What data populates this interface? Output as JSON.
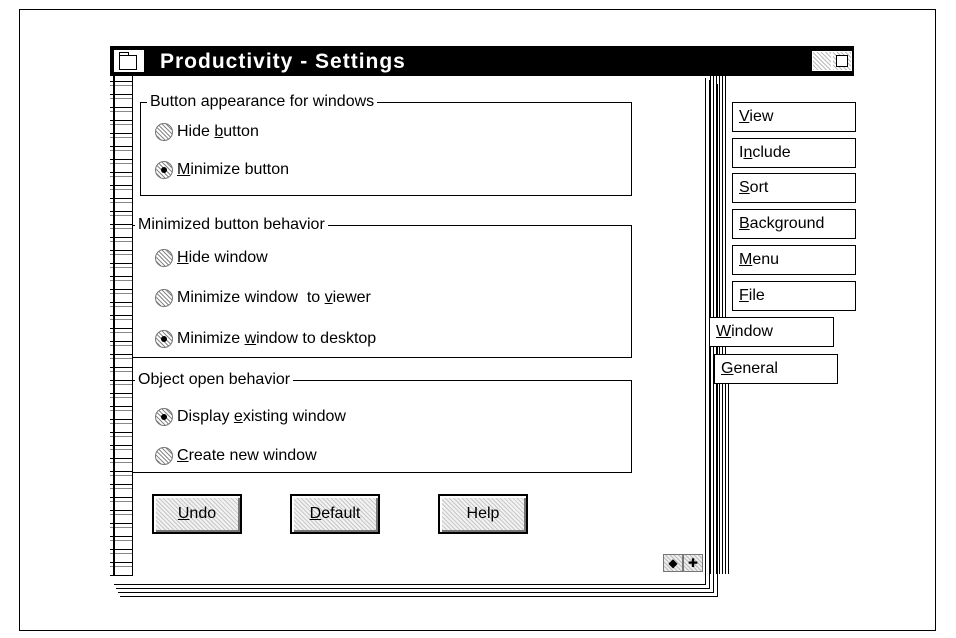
{
  "window": {
    "title": "Productivity - Settings"
  },
  "groups": {
    "button_appearance": {
      "label": "Button appearance for windows",
      "options": [
        {
          "pre": "Hide ",
          "key": "b",
          "post": "utton",
          "checked": false
        },
        {
          "pre": "",
          "key": "M",
          "post": "inimize button",
          "checked": true
        }
      ]
    },
    "minimized_behavior": {
      "label": "Minimized button behavior",
      "options": [
        {
          "pre": "",
          "key": "H",
          "post": "ide window",
          "checked": false
        },
        {
          "pre": "Minimize window  to ",
          "key": "v",
          "post": "iewer",
          "checked": false
        },
        {
          "pre": "Minimize ",
          "key": "w",
          "post": "indow to desktop",
          "checked": true
        }
      ]
    },
    "object_open": {
      "label": "Object open behavior",
      "options": [
        {
          "pre": "Display ",
          "key": "e",
          "post": "xisting window",
          "checked": true
        },
        {
          "pre": "",
          "key": "C",
          "post": "reate new window",
          "checked": false
        }
      ]
    }
  },
  "buttons": {
    "undo": {
      "pre": "",
      "key": "U",
      "post": "ndo"
    },
    "default": {
      "pre": "",
      "key": "D",
      "post": "efault"
    },
    "help": {
      "pre": "",
      "key": "",
      "post": "Help"
    }
  },
  "page_nav": {
    "prev": "◆",
    "next": "✚"
  },
  "tabs": [
    {
      "pre": "",
      "key": "V",
      "post": "iew"
    },
    {
      "pre": "I",
      "key": "n",
      "post": "clude"
    },
    {
      "pre": "",
      "key": "S",
      "post": "ort"
    },
    {
      "pre": "",
      "key": "B",
      "post": "ackground"
    },
    {
      "pre": "",
      "key": "M",
      "post": "enu"
    },
    {
      "pre": "",
      "key": "F",
      "post": "ile"
    },
    {
      "pre": "",
      "key": "W",
      "post": "indow"
    },
    {
      "pre": "",
      "key": "G",
      "post": "eneral"
    }
  ],
  "active_tab": "Window"
}
